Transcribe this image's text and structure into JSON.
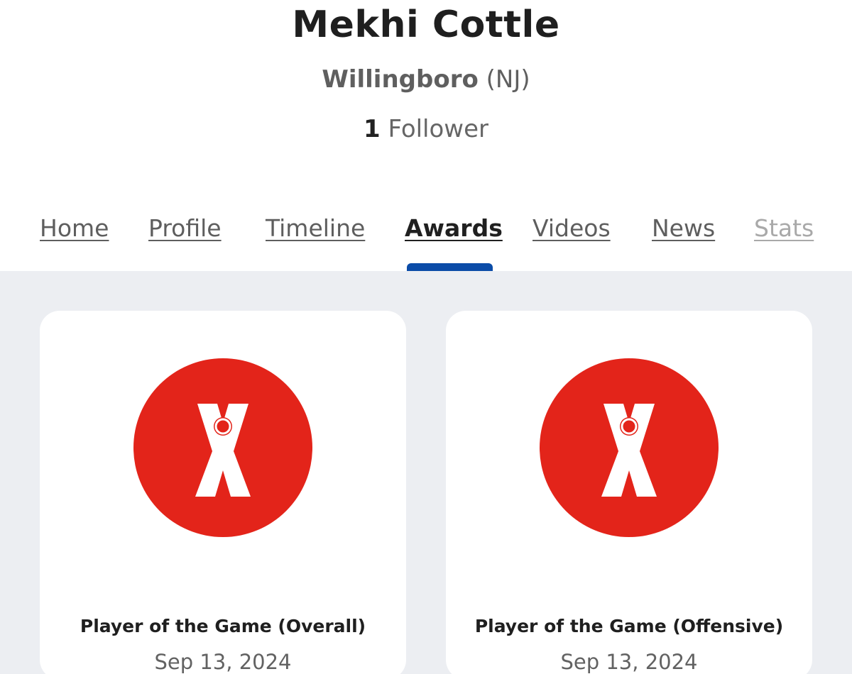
{
  "profile": {
    "name": "Mekhi Cottle",
    "school": "Willingboro",
    "state": "(NJ)",
    "followers": {
      "count": "1",
      "label": "Follower"
    }
  },
  "tabs": [
    {
      "label": "Home",
      "active": false
    },
    {
      "label": "Profile",
      "active": false
    },
    {
      "label": "Timeline",
      "active": false
    },
    {
      "label": "Awards",
      "active": true
    },
    {
      "label": "Videos",
      "active": false
    },
    {
      "label": "News",
      "active": false
    },
    {
      "label": "Stats",
      "active": false
    }
  ],
  "awards": [
    {
      "title": "Player of the Game (Overall)",
      "date": "Sep 13, 2024",
      "icon": "award-medal-x-icon"
    },
    {
      "title": "Player of the Game (Offensive)",
      "date": "Sep 13, 2024",
      "icon": "award-medal-x-icon"
    }
  ],
  "colors": {
    "active_tab_indicator": "#0b4ca8",
    "award_icon": "#e3241a",
    "content_background": "#eceef2"
  }
}
